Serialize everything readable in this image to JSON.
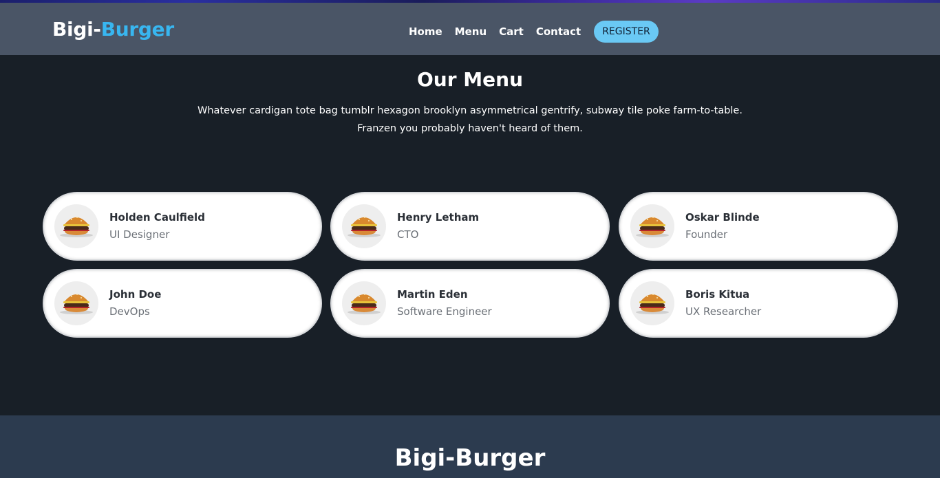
{
  "navbar": {
    "logo_part1": "Bigi-",
    "logo_part2": "Burger",
    "links": [
      "Home",
      "Menu",
      "Cart",
      "Contact"
    ],
    "register_label": "REGISTER"
  },
  "menu": {
    "title": "Our Menu",
    "description": "Whatever cardigan tote bag tumblr hexagon brooklyn asymmetrical gentrify, subway tile poke farm-to-table. Franzen you probably haven't heard of them.",
    "items": [
      {
        "name": "Holden Caulfield",
        "role": "UI Designer",
        "icon": "burger-icon"
      },
      {
        "name": "Henry Letham",
        "role": "CTO",
        "icon": "burger-icon"
      },
      {
        "name": "Oskar Blinde",
        "role": "Founder",
        "icon": "burger-icon"
      },
      {
        "name": "John Doe",
        "role": "DevOps",
        "icon": "burger-icon"
      },
      {
        "name": "Martin Eden",
        "role": "Software Engineer",
        "icon": "burger-icon"
      },
      {
        "name": "Boris Kitua",
        "role": "UX Researcher",
        "icon": "burger-icon"
      }
    ]
  },
  "footer": {
    "title": "Bigi-Burger"
  },
  "colors": {
    "navbar_bg": "#4a5566",
    "page_bg": "#181f27",
    "accent": "#38b6f0",
    "register_bg": "#6ac9f5",
    "footer_bg": "#2c3b4f"
  }
}
